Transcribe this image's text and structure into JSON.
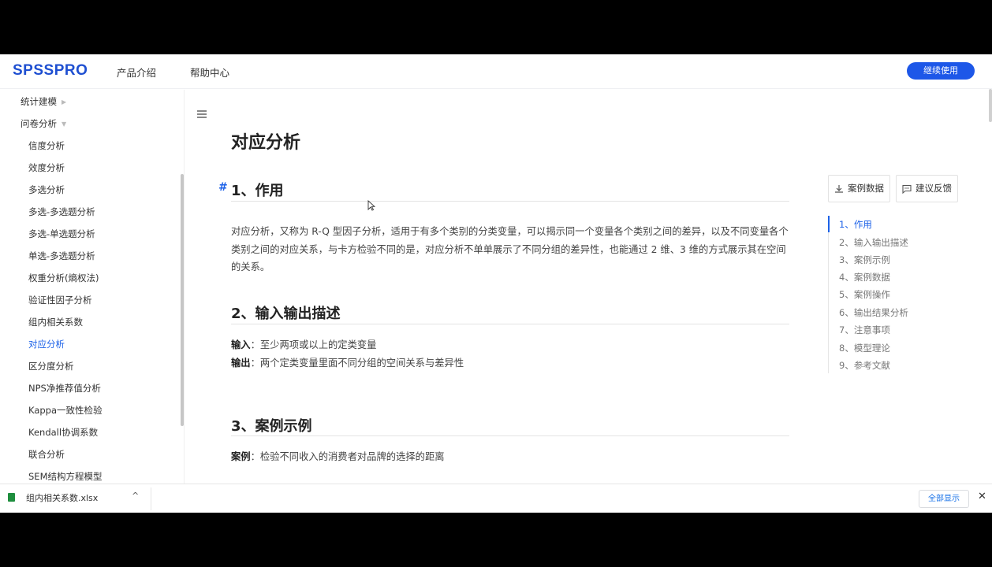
{
  "header": {
    "logo": "SPSSPRO",
    "nav": [
      "产品介绍",
      "帮助中心"
    ],
    "cta_label": "继续使用"
  },
  "sidebar": {
    "items": [
      {
        "label": "统计建模",
        "caret": "right"
      },
      {
        "label": "问卷分析",
        "caret": "down"
      },
      {
        "label": "信度分析"
      },
      {
        "label": "效度分析"
      },
      {
        "label": "多选分析"
      },
      {
        "label": "多选-多选题分析"
      },
      {
        "label": "多选-单选题分析"
      },
      {
        "label": "单选-多选题分析"
      },
      {
        "label": "权重分析(熵权法)"
      },
      {
        "label": "验证性因子分析"
      },
      {
        "label": "组内相关系数"
      },
      {
        "label": "对应分析",
        "active": true
      },
      {
        "label": "区分度分析"
      },
      {
        "label": "NPS净推荐值分析"
      },
      {
        "label": "Kappa一致性检验"
      },
      {
        "label": "Kendall协调系数"
      },
      {
        "label": "联合分析"
      },
      {
        "label": "SEM结构方程模型"
      }
    ]
  },
  "article": {
    "title": "对应分析",
    "anchor": "#",
    "sections": [
      {
        "heading": "1、作用",
        "body": "对应分析，又称为 R-Q 型因子分析，适用于有多个类别的分类变量，可以揭示同一个变量各个类别之间的差异，以及不同变量各个类别之间的对应关系，与卡方检验不同的是，对应分析不单单展示了不同分组的差异性，也能通过 2 维、3 维的方式展示其在空间的关系。"
      },
      {
        "heading": "2、输入输出描述",
        "input_key": "输入",
        "input_val": "：至少两项或以上的定类变量",
        "output_key": "输出",
        "output_val": "：两个定类变量里面不同分组的空间关系与差异性"
      },
      {
        "heading": "3、案例示例",
        "case_key": "案例",
        "case_val": "：检验不同收入的消费者对品牌的选择的距离"
      }
    ]
  },
  "tools": {
    "download_label": "案例数据",
    "feedback_label": "建议反馈"
  },
  "toc": [
    "1、作用",
    "2、输入输出描述",
    "3、案例示例",
    "4、案例数据",
    "5、案例操作",
    "6、输出结果分析",
    "7、注意事项",
    "8、模型理论",
    "9、参考文献"
  ],
  "downloads": {
    "file_name": "组内相关系数.xlsx",
    "show_all": "全部显示",
    "close": "✕",
    "chevron": "^"
  },
  "colors": {
    "brand": "#1e4fd1",
    "accent": "#1d62e8"
  }
}
